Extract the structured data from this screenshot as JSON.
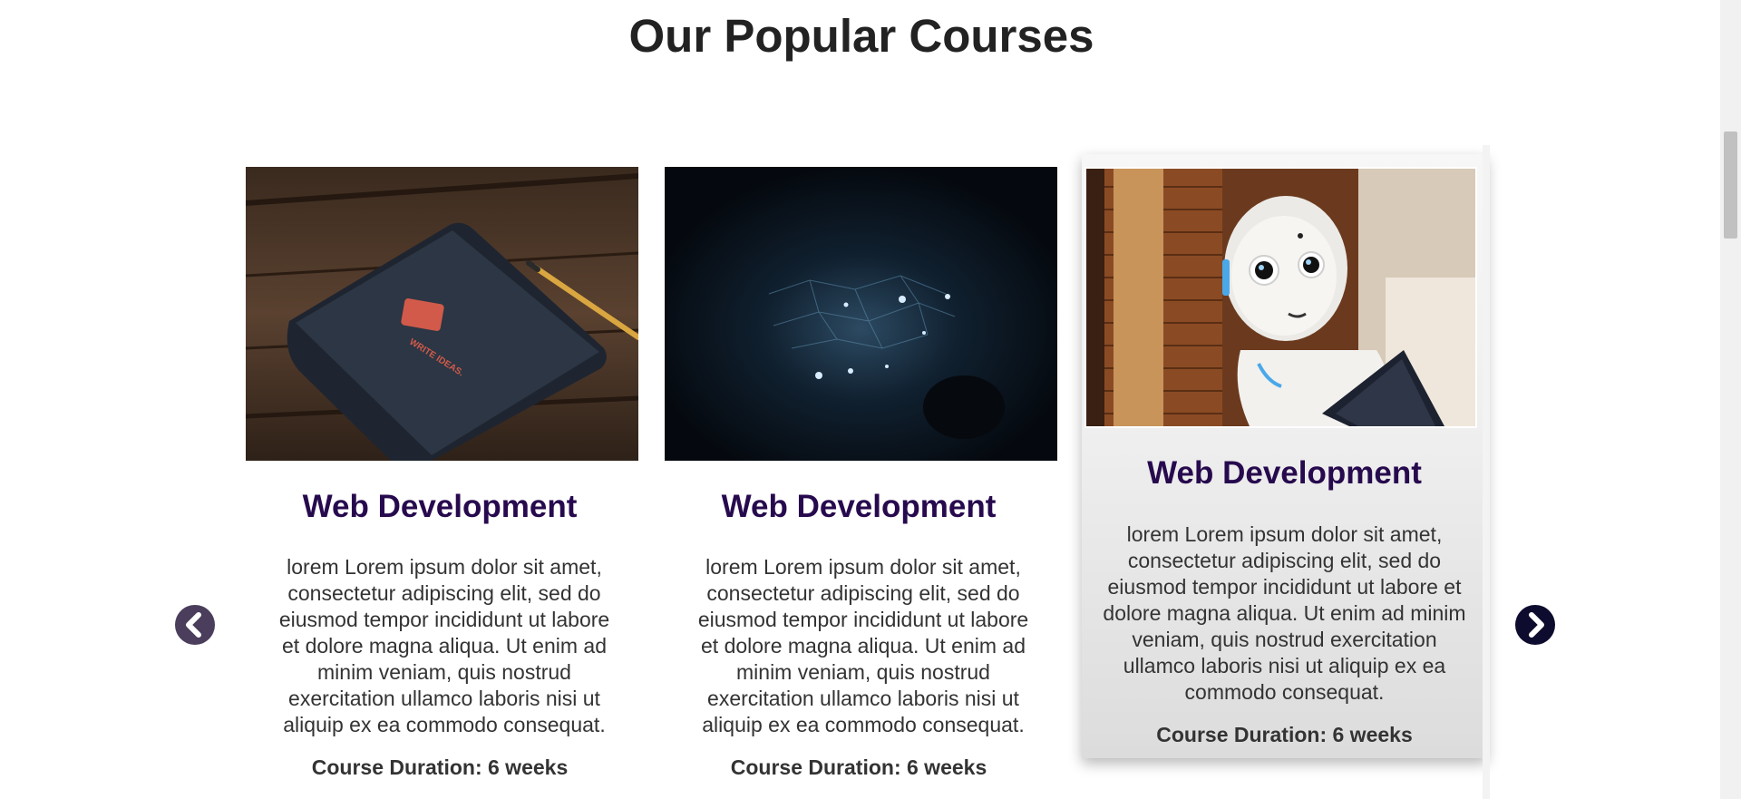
{
  "section": {
    "title": "Our Popular Courses"
  },
  "courses": [
    {
      "title": "Web Development",
      "description": "lorem Lorem ipsum dolor sit amet, consectetur adipiscing elit, sed do eiusmod tempor incididunt ut labore et dolore magna aliqua. Ut enim ad minim veniam, quis nostrud exercitation ullamco laboris nisi ut aliquip ex ea commodo consequat.",
      "duration": "Course Duration: 6 weeks",
      "image_icon": "notebook-image"
    },
    {
      "title": "Web Development",
      "description": "lorem Lorem ipsum dolor sit amet, consectetur adipiscing elit, sed do eiusmod tempor incididunt ut labore et dolore magna aliqua. Ut enim ad minim veniam, quis nostrud exercitation ullamco laboris nisi ut aliquip ex ea commodo consequat.",
      "duration": "Course Duration: 6 weeks",
      "image_icon": "network-image"
    },
    {
      "title": "Web Development",
      "description": "lorem Lorem ipsum dolor sit amet, consectetur adipiscing elit, sed do eiusmod tempor incididunt ut labore et dolore magna aliqua. Ut enim ad minim veniam, quis nostrud exercitation ullamco laboris nisi ut aliquip ex ea commodo consequat.",
      "duration": "Course Duration: 6 weeks",
      "image_icon": "robot-image"
    }
  ],
  "controls": {
    "prev_icon": "chevron-left-icon",
    "next_icon": "chevron-right-icon"
  },
  "colors": {
    "title_text": "#222222",
    "course_title": "#270a4e",
    "body_text": "#333333",
    "prev_arrow": "#4a3e5c",
    "next_arrow": "#0d0b2e"
  }
}
